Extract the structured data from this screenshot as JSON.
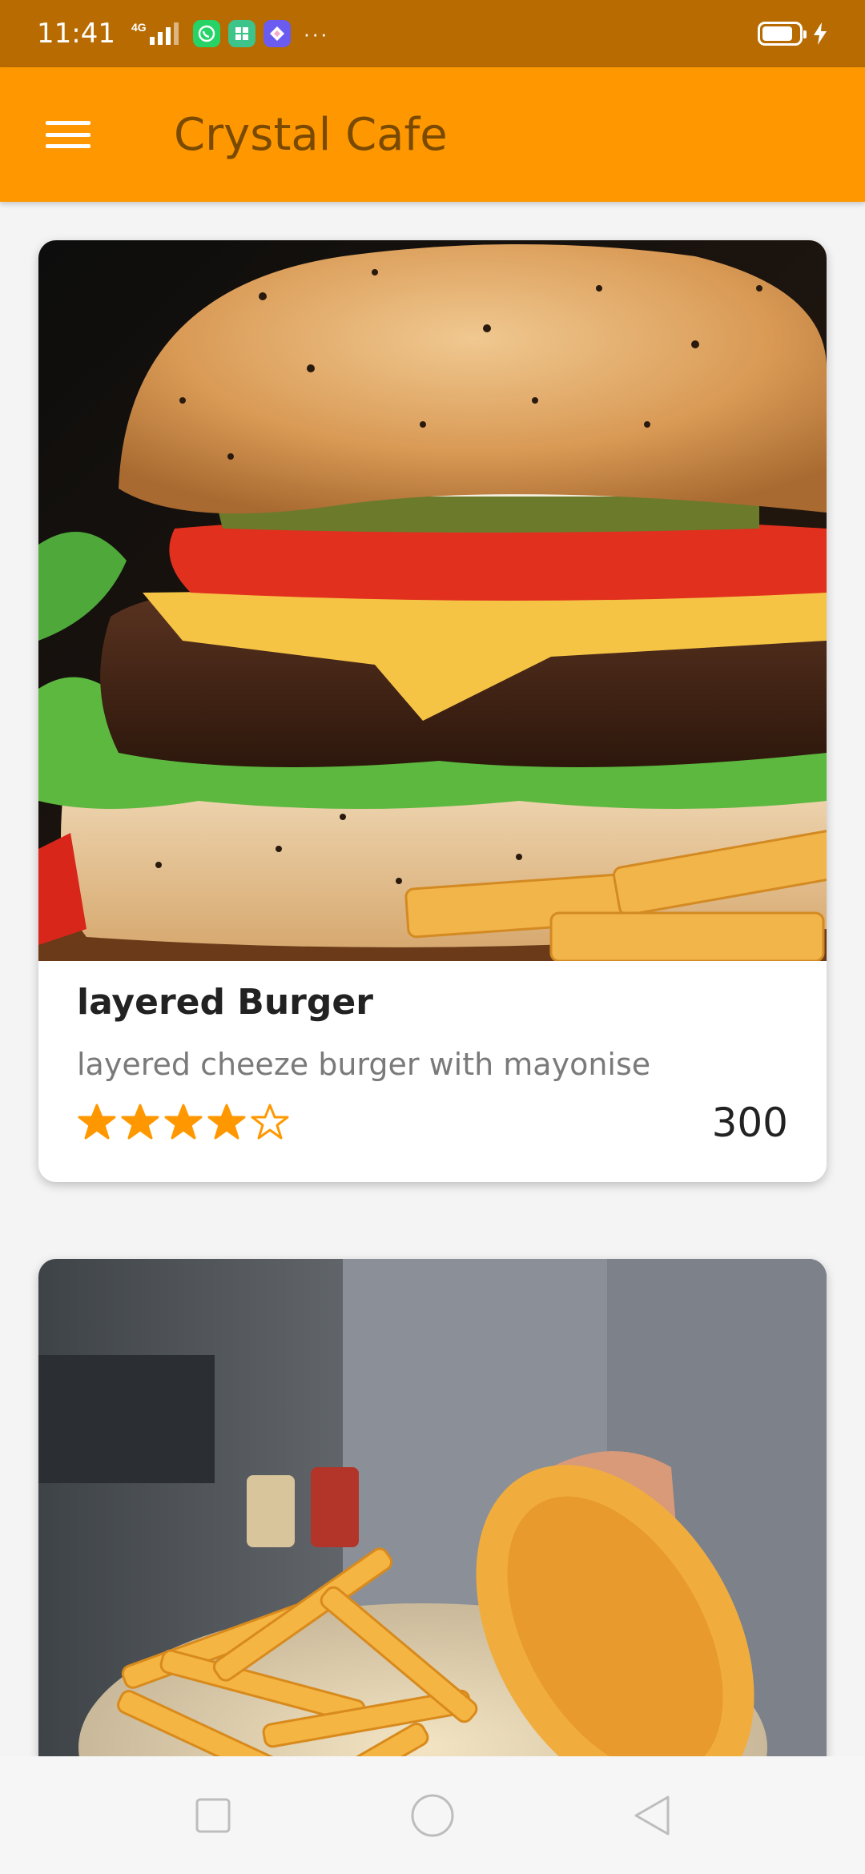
{
  "status_bar": {
    "time": "11:41",
    "network": "4G",
    "battery_level": 0.85
  },
  "app_bar": {
    "title": "Crystal Cafe",
    "menu_icon": "hamburger-menu-icon",
    "color": "#ff9800",
    "title_color": "#7a4a00"
  },
  "items": [
    {
      "name": "layered Burger",
      "description": "layered cheeze burger with mayonise",
      "rating": 4,
      "rating_max": 5,
      "price": "300",
      "image": "burger-photo"
    },
    {
      "image": "fries-plate-photo"
    }
  ],
  "colors": {
    "accent": "#ff9800",
    "star": "#ff9800",
    "status_bar": "#b86b00"
  },
  "nav_bar": {
    "icons": [
      "recents-square-icon",
      "home-circle-icon",
      "back-triangle-icon"
    ]
  }
}
